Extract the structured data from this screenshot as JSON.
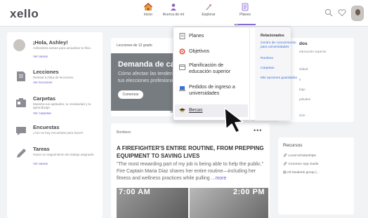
{
  "app": {
    "logo": "xello"
  },
  "nav": {
    "inicio": "Inicio",
    "acerca": "Acerca de mí",
    "explorar": "Explorar",
    "planes": "Planes"
  },
  "topbar": {
    "search_icon": "search-icon",
    "heart_icon": "heart-icon"
  },
  "sidebar": {
    "greeting": {
      "title": "¡Hola, Ashley!",
      "sub": "Administra tareas para actualizar tu flexi.",
      "link": "Ver tareas"
    },
    "lecciones": {
      "title": "Lecciones",
      "sub": "Revisar tu lista de lecciones.",
      "link": "Ver lecciones"
    },
    "carpetas": {
      "title": "Carpetas",
      "sub": "Muestra tus aptitudes, tu creatividad y tu aprendizaje.",
      "link": "Ver carpetas"
    },
    "encuestas": {
      "title": "Encuestas",
      "sub": "¡Aún no hay encuestas para hacer!"
    },
    "tareas": {
      "title": "Tareas",
      "sub": "Hacer un seguimiento de trabajo asignado.",
      "link": "Ver tareas"
    }
  },
  "lessons": {
    "head": "Lecciones de 12 grado",
    "banner_title": "Demanda de carreras",
    "banner_sub1": "Cómo afectan las tendencias",
    "banner_sub2": "tus elecciones profesionales",
    "button": "Comenzar",
    "foot": "Ve"
  },
  "article": {
    "source": "Bombero",
    "more": "•••",
    "title": "A FIREFIGHTER'S ENTIRE ROUTINE, FROM PREPPING EQUIPMENT TO SAVING LIVES",
    "body": "\"The most rewarding part of my job is being able to help the public.\" Fire Captain Maria Diaz shares her entire routine—including her fitness and wellness practices while pulling ",
    "more_link": "...more",
    "time1": "7:00 AM",
    "time2": "2:00 PM"
  },
  "right_card": {
    "title": "dos",
    "line1": "educación superior",
    "line2": "alidad",
    "line3": "s",
    "line4": "bajo",
    "line5": "ptitudes",
    "line6": "sión"
  },
  "resources": {
    "title": "Recursos",
    "items": [
      "Local scholarships",
      "Common App Guide",
      "All Students group (..."
    ]
  },
  "dropdown": {
    "items": [
      "Planes",
      "Objetivos",
      "Planificación de educación superior",
      "Pedidos de ingreso a universidades",
      "Becas"
    ],
    "related_head": "Relacionados",
    "related": [
      "Centro de conocimiento para universidades",
      "Rumbos",
      "Carpetas",
      "Mis opciones guardadas"
    ]
  },
  "colors": {
    "accent": "#8a6ad6",
    "link": "#3a6fd8",
    "objetivos": "#e0523a"
  }
}
